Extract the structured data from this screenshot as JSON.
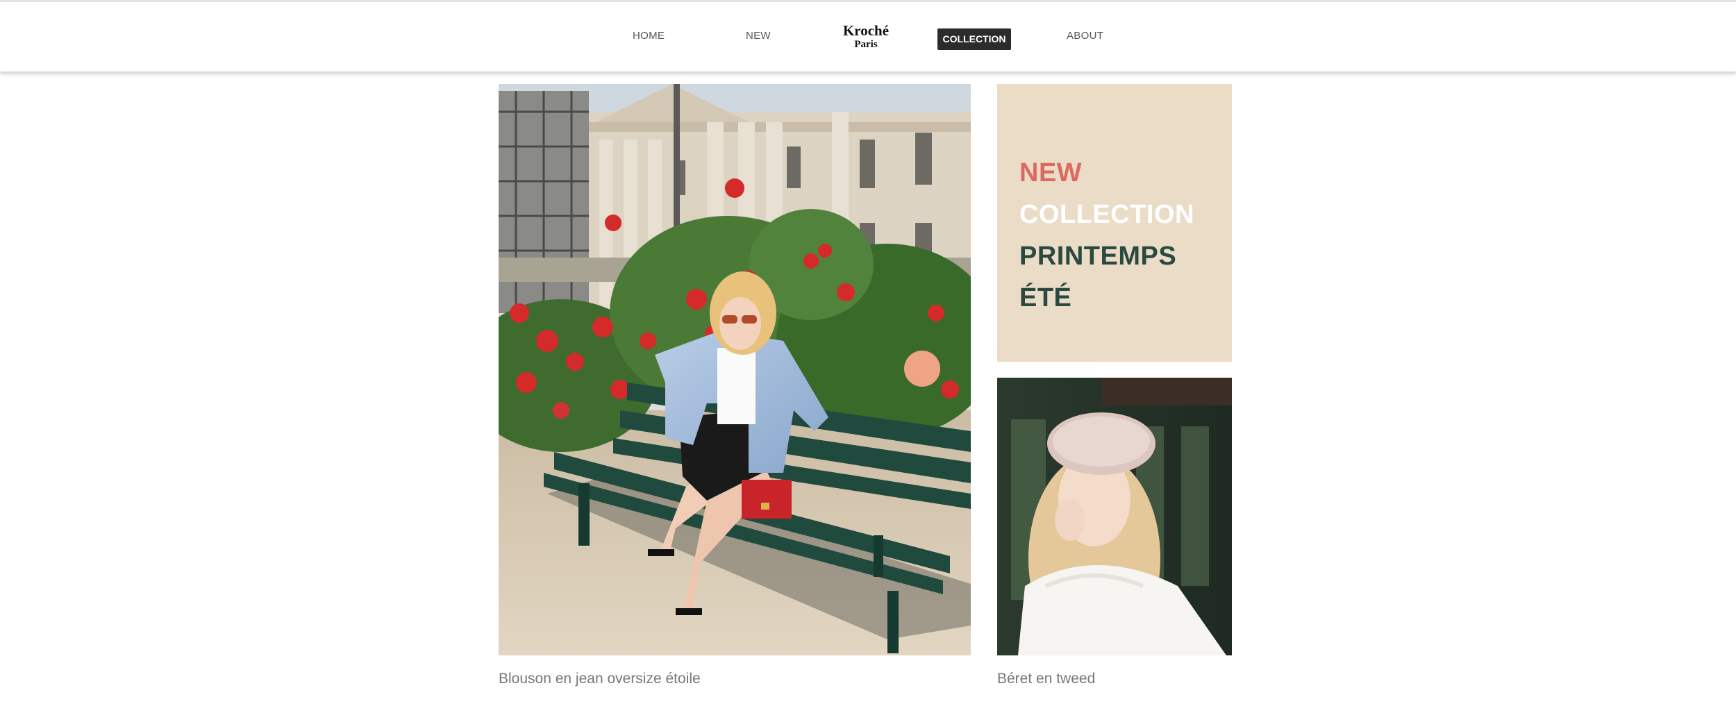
{
  "header": {
    "nav": {
      "home": "HOME",
      "new": "NEW",
      "collection": "COLLECTION",
      "about": "ABOUT"
    },
    "logo": {
      "main": "Kroché",
      "sub": "Paris"
    }
  },
  "promo": {
    "line1": "NEW",
    "line2": "COLLECTION",
    "line3": "PRINTEMPS",
    "line4": "ÉTÉ",
    "colors": {
      "background": "#ebdcc8",
      "line1": "#dc6a62",
      "line2": "#ffffff",
      "line3": "#2a4a40",
      "line4": "#2a4a40"
    }
  },
  "products": [
    {
      "caption": "Blouson en jean oversize étoile"
    },
    {
      "caption": "Béret en tweed"
    }
  ],
  "colors": {
    "nav_active_bg": "#2b2b2b",
    "caption_text": "#777777"
  }
}
